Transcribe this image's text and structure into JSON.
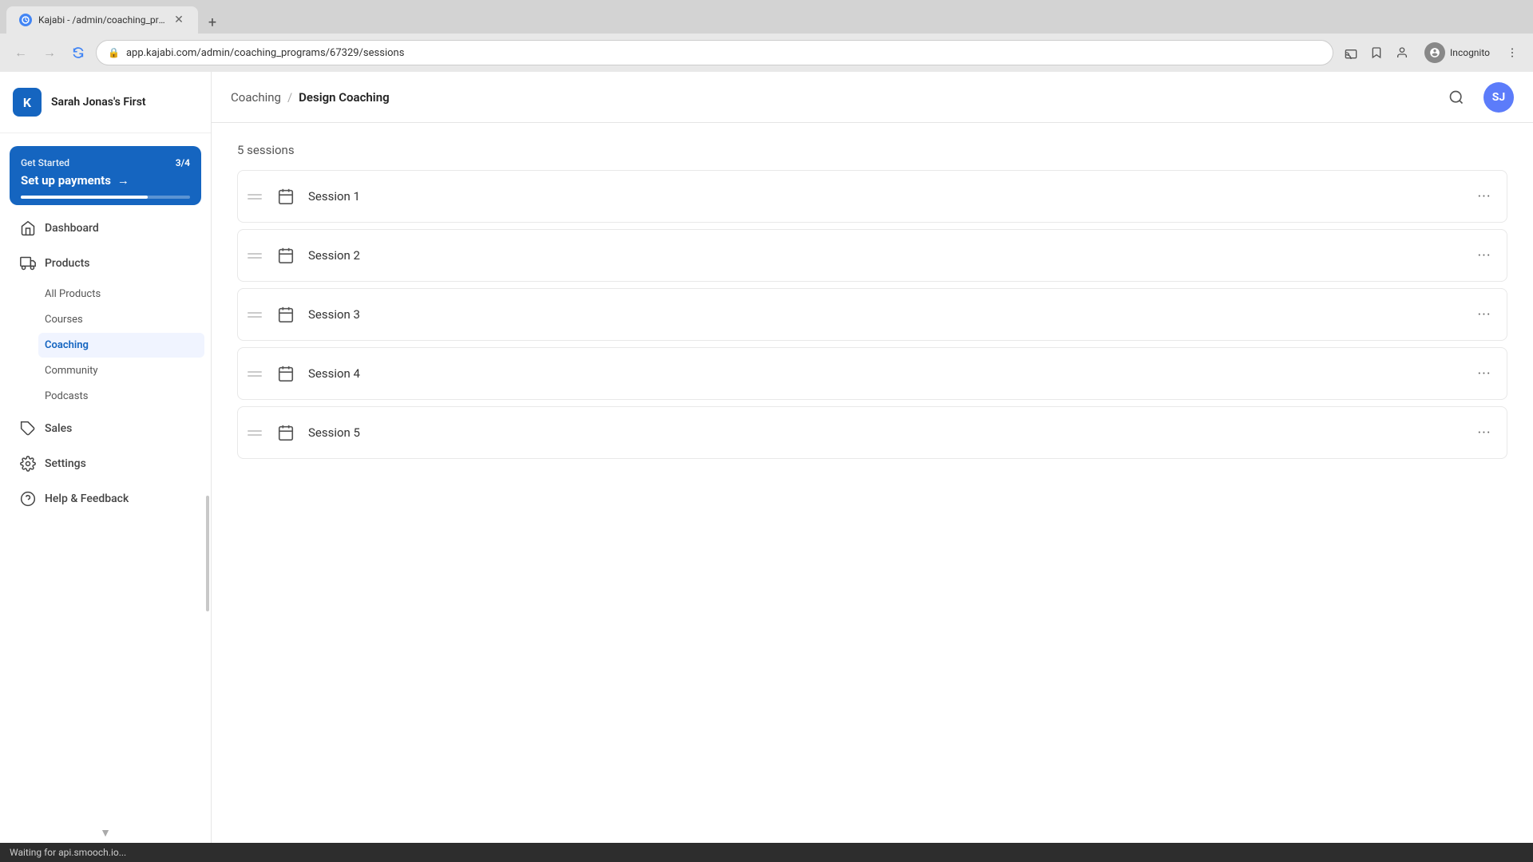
{
  "browser": {
    "tab_label": "Kajabi - /admin/coaching_progra...",
    "url": "app.kajabi.com/admin/coaching_programs/67329/sessions",
    "loading": true,
    "incognito_label": "Incognito"
  },
  "sidebar": {
    "logo_text": "K",
    "app_title": "Sarah Jonas's First",
    "get_started": {
      "label": "Get Started",
      "count": "3/4",
      "cta": "Set up payments",
      "cta_arrow": "→",
      "progress": 75
    },
    "nav_items": [
      {
        "id": "dashboard",
        "label": "Dashboard"
      },
      {
        "id": "products",
        "label": "Products"
      }
    ],
    "products_subnav": [
      {
        "id": "all-products",
        "label": "All Products"
      },
      {
        "id": "courses",
        "label": "Courses"
      },
      {
        "id": "coaching",
        "label": "Coaching",
        "active": true
      },
      {
        "id": "community",
        "label": "Community"
      },
      {
        "id": "podcasts",
        "label": "Podcasts"
      }
    ],
    "bottom_nav": [
      {
        "id": "sales",
        "label": "Sales"
      },
      {
        "id": "settings",
        "label": "Settings"
      },
      {
        "id": "help",
        "label": "Help & Feedback"
      }
    ]
  },
  "breadcrumb": {
    "parent": "Coaching",
    "separator": "/",
    "current": "Design Coaching"
  },
  "topbar": {
    "user_initials": "SJ"
  },
  "main": {
    "sessions_count": "5 sessions",
    "sessions": [
      {
        "id": 1,
        "label": "Session 1"
      },
      {
        "id": 2,
        "label": "Session 2"
      },
      {
        "id": 3,
        "label": "Session 3"
      },
      {
        "id": 4,
        "label": "Session 4"
      },
      {
        "id": 5,
        "label": "Session 5"
      }
    ]
  },
  "status_bar": {
    "text": "Waiting for api.smooch.io..."
  }
}
